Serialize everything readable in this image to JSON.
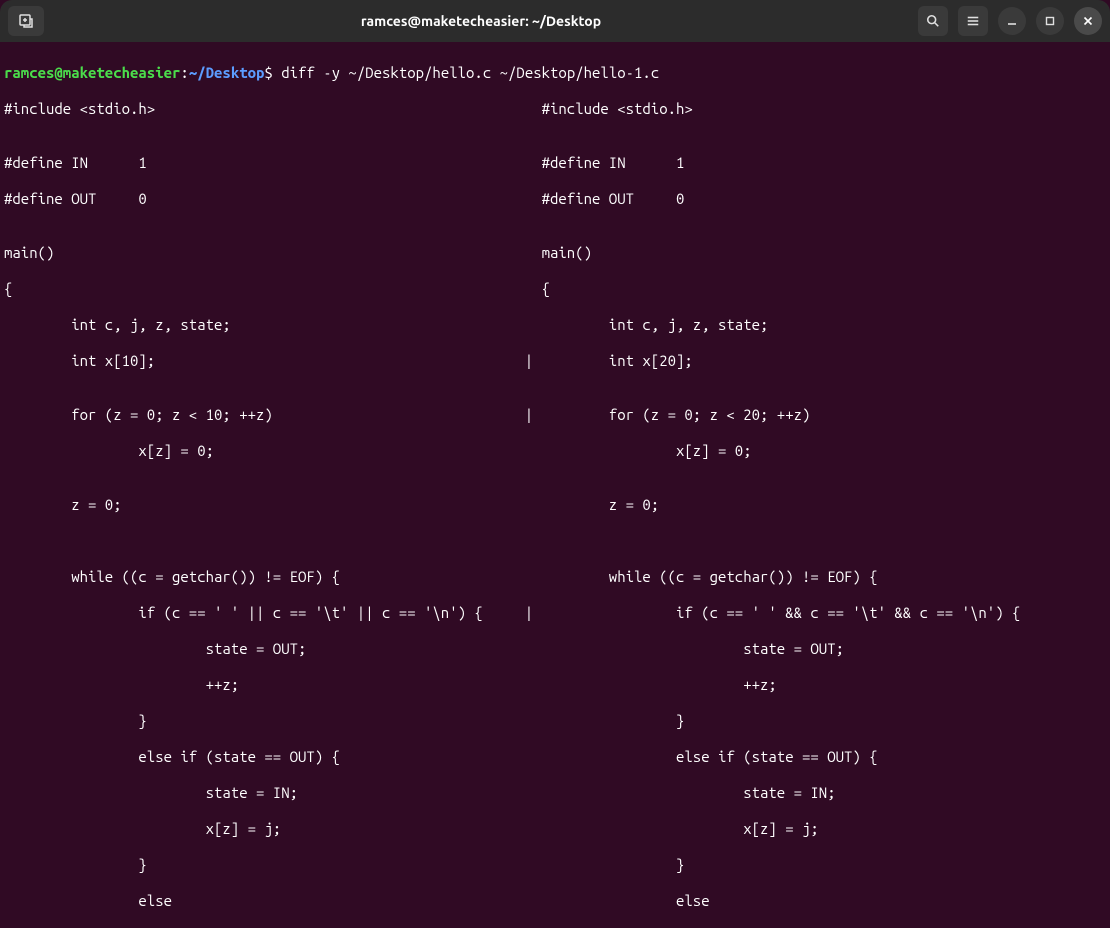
{
  "window": {
    "title": "ramces@maketecheasier: ~/Desktop"
  },
  "prompt": {
    "user_host": "ramces@maketecheasier",
    "colon": ":",
    "path": "~/Desktop",
    "dollar": "$"
  },
  "command": " diff -y ~/Desktop/hello.c ~/Desktop/hello-1.c",
  "output": [
    "#include <stdio.h>                                              #include <stdio.h>",
    "",
    "#define IN      1                                               #define IN      1",
    "#define OUT     0                                               #define OUT     0",
    "",
    "main()                                                          main()",
    "{                                                               {",
    "        int c, j, z, state;                                             int c, j, z, state;",
    "        int x[10];                                            |         int x[20];",
    "",
    "        for (z = 0; z < 10; ++z)                              |         for (z = 0; z < 20; ++z)",
    "                x[z] = 0;                                                       x[z] = 0;",
    "",
    "        z = 0;                                                          z = 0;",
    "",
    "",
    "        while ((c = getchar()) != EOF) {                                while ((c = getchar()) != EOF) {",
    "                if (c == ' ' || c == '\\t' || c == '\\n') {     |                 if (c == ' ' && c == '\\t' && c == '\\n') {",
    "                        state = OUT;                                                    state = OUT;",
    "                        ++z;                                                            ++z;",
    "                }                                                               }",
    "                else if (state == OUT) {                                        else if (state == OUT) {",
    "                        state = IN;                                                     state = IN;",
    "                        x[z] = j;                                                       x[z] = j;",
    "                }                                                               }",
    "                else                                                            else"
  ]
}
